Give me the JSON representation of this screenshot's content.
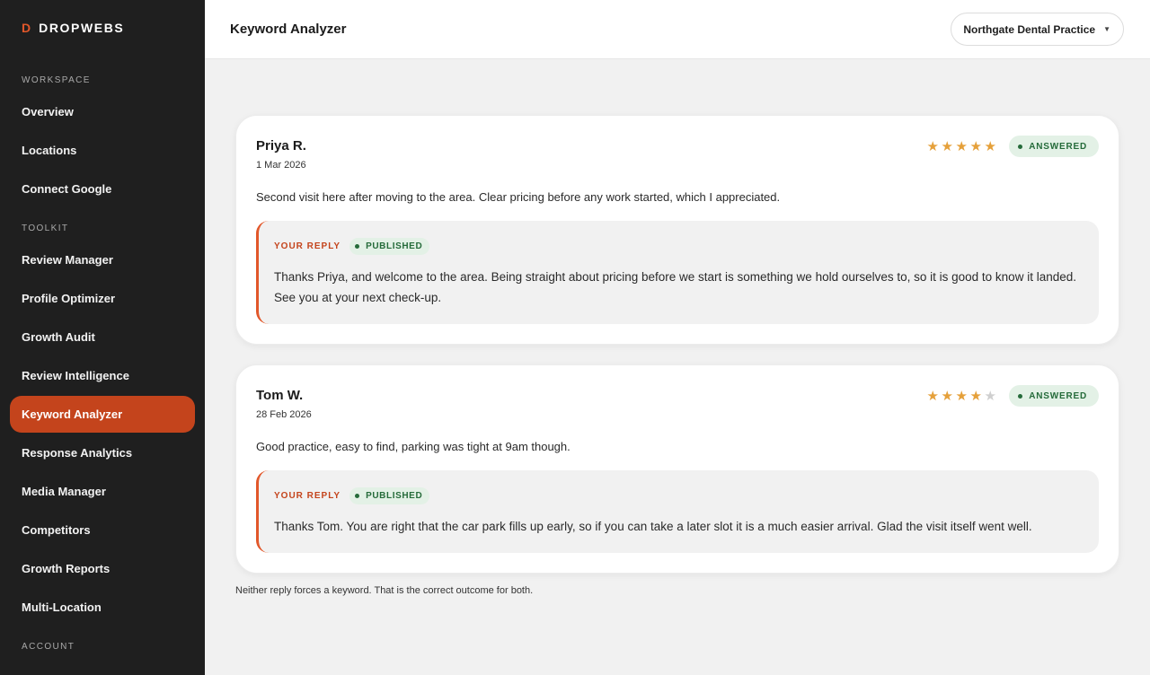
{
  "brand": {
    "mark": "D",
    "name": "DROPWEBS"
  },
  "sidebar": {
    "workspace_label": "WORKSPACE",
    "workspace_items": [
      "Overview",
      "Locations",
      "Connect Google"
    ],
    "toolkit_label": "TOOLKIT",
    "toolkit_items": [
      "Review Manager",
      "Profile Optimizer",
      "Growth Audit",
      "Review Intelligence",
      "Keyword Analyzer",
      "Response Analytics",
      "Media Manager",
      "Competitors",
      "Growth Reports",
      "Multi-Location"
    ],
    "active_item": "Keyword Analyzer",
    "account_label": "ACCOUNT"
  },
  "header": {
    "title": "Keyword Analyzer",
    "location": "Northgate Dental Practice"
  },
  "reviews": [
    {
      "author": "Priya R.",
      "date": "1 Mar 2026",
      "rating": 5,
      "status": "ANSWERED",
      "text": "Second visit here after moving to the area. Clear pricing before any work started, which I appreciated.",
      "reply_label": "YOUR REPLY",
      "reply_status": "PUBLISHED",
      "reply_text": "Thanks Priya, and welcome to the area. Being straight about pricing before we start is something we hold ourselves to, so it is good to know it landed. See you at your next check-up."
    },
    {
      "author": "Tom W.",
      "date": "28 Feb 2026",
      "rating": 4,
      "status": "ANSWERED",
      "text": "Good practice, easy to find, parking was tight at 9am though.",
      "reply_label": "YOUR REPLY",
      "reply_status": "PUBLISHED",
      "reply_text": "Thanks Tom. You are right that the car park fills up early, so if you can take a later slot it is a much easier arrival. Glad the visit itself went well."
    }
  ],
  "footnote": "Neither reply forces a keyword. That is the correct outcome for both.",
  "colors": {
    "accent": "#c4441c",
    "brand_mark": "#e2572a",
    "star": "#e5a03a",
    "status_green": "#256b3a",
    "sidebar_bg": "#1f1f1f"
  }
}
